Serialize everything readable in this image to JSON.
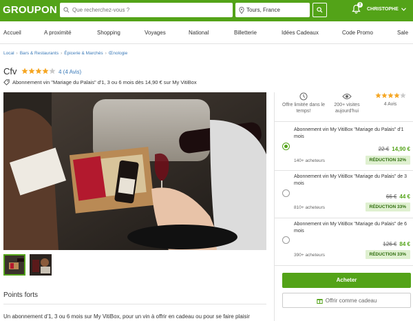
{
  "header": {
    "logo": "GROUPON",
    "search_placeholder": "Que recherchez-vous ?",
    "location_value": "Tours, France",
    "notification_count": "3",
    "user_name": "CHRISTOPHE"
  },
  "nav": {
    "items": [
      "Accueil",
      "A proximité",
      "Shopping",
      "Voyages",
      "National",
      "Billetterie",
      "Idées Cadeaux",
      "Code Promo",
      "Sale"
    ]
  },
  "breadcrumb": [
    "Local",
    "Bars & Restaurants",
    "Épicerie & Marchés",
    "Œnologie"
  ],
  "deal": {
    "title": "Cfv",
    "rating": 4,
    "reviews_label": "4 (4 Avis)",
    "subtitle": "Abonnement vin \"Mariage du Palais\" d'1, 3 ou 6 mois dès 14,90 € sur My VitiBox"
  },
  "features": {
    "limited_label": "Offre limitée dans le temps!",
    "visits_label": "200+ visites aujourd'hui",
    "rating_label": "4 Avis"
  },
  "options": [
    {
      "title": "Abonnement vin My VitiBox \"Mariage du Palais\" d'1 mois",
      "old_price": "22 €",
      "new_price": "14,90 €",
      "buyers": "140+ acheteurs",
      "reduction": "RÉDUCTION 32%",
      "selected": true
    },
    {
      "title": "Abonnement vin My VitiBox \"Mariage du Palais\" de 3 mois",
      "old_price": "66 €",
      "new_price": "44 €",
      "buyers": "810+ acheteurs",
      "reduction": "RÉDUCTION 33%",
      "selected": false
    },
    {
      "title": "Abonnement vin My VitiBox \"Mariage du Palais\" de 6 mois",
      "old_price": "126 €",
      "new_price": "84 €",
      "buyers": "390+ acheteurs",
      "reduction": "RÉDUCTION 33%",
      "selected": false
    }
  ],
  "actions": {
    "buy_label": "Acheter",
    "gift_label": "Offrir comme cadeau"
  },
  "section": {
    "heading": "Points forts",
    "description": "Un abonnement d'1, 3 ou 6 mois sur My VitiBox, pour un vin à offrir en cadeau ou pour se faire plaisir"
  },
  "colors": {
    "brand": "#53a318",
    "link": "#3b7ab8",
    "star": "#f5a623"
  },
  "icons": [
    "search-icon",
    "map-pin-icon",
    "bell-icon",
    "chevron-down-icon",
    "tag-icon",
    "clock-icon",
    "eye-icon",
    "gift-icon",
    "star-icon"
  ]
}
